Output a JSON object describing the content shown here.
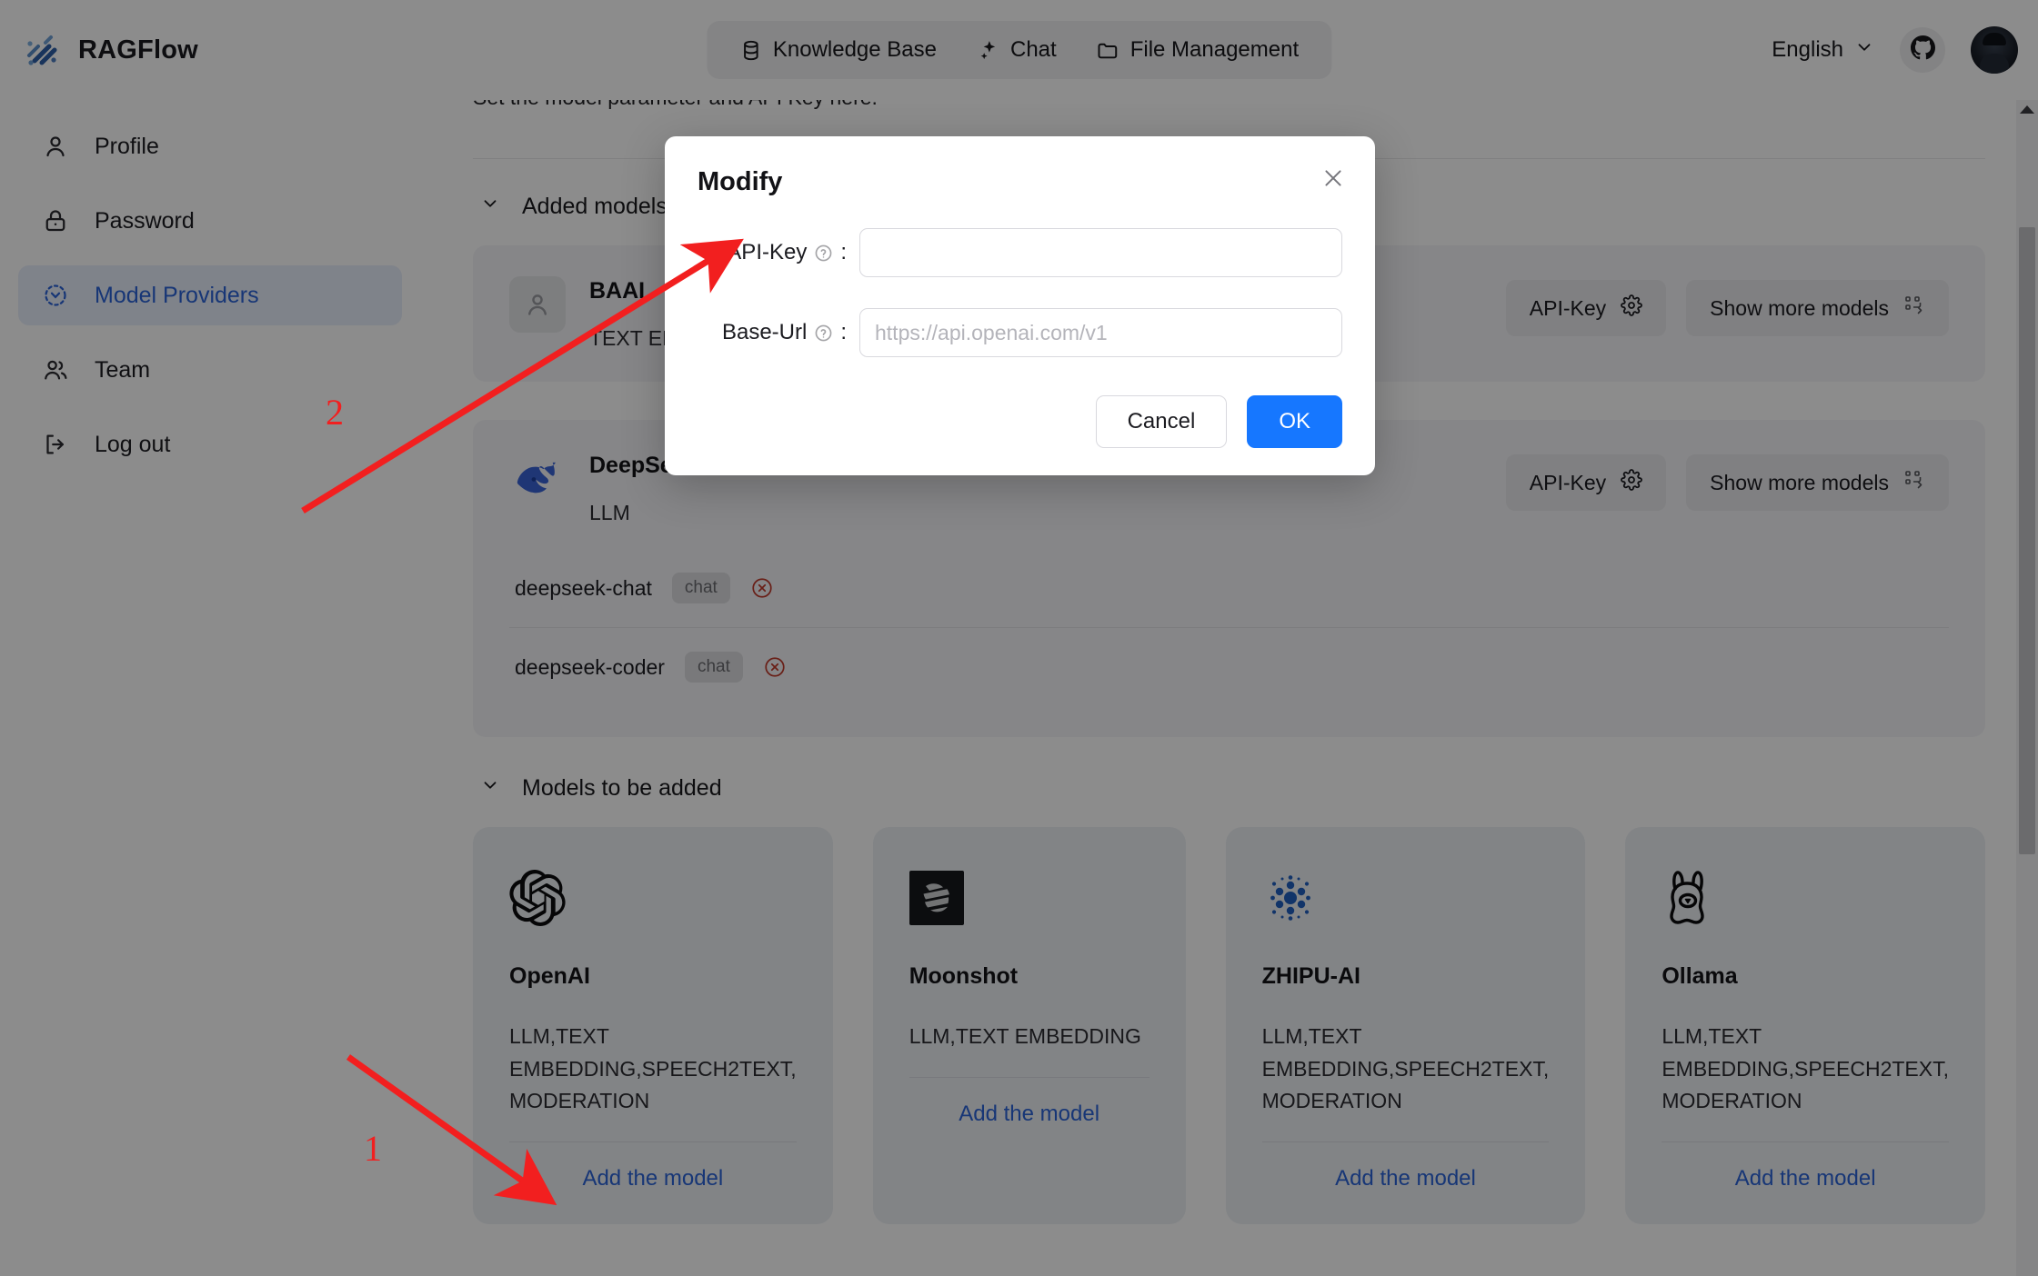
{
  "header": {
    "brand": "RAGFlow",
    "nav": [
      {
        "label": "Knowledge Base",
        "icon": "database-icon"
      },
      {
        "label": "Chat",
        "icon": "sparkle-icon"
      },
      {
        "label": "File Management",
        "icon": "folder-icon"
      }
    ],
    "language": "English",
    "github_icon": "github-icon",
    "avatar_icon": "user-avatar"
  },
  "sidebar": {
    "items": [
      {
        "label": "Profile",
        "icon": "user-icon",
        "active": false
      },
      {
        "label": "Password",
        "icon": "lock-icon",
        "active": false
      },
      {
        "label": "Model Providers",
        "icon": "model-providers-icon",
        "active": true
      },
      {
        "label": "Team",
        "icon": "team-icon",
        "active": false
      },
      {
        "label": "Log out",
        "icon": "logout-icon",
        "active": false
      }
    ]
  },
  "main": {
    "subtitle": "Set the model parameter and API Key here.",
    "added_models_header": "Added models",
    "to_be_added_header": "Models to be added",
    "added_providers": [
      {
        "name": "BAAI",
        "tags": "TEXT EMBEDDING",
        "api_key_label": "API-Key",
        "show_more_label": "Show more models",
        "models": []
      },
      {
        "name": "DeepSeek",
        "tags": "LLM",
        "api_key_label": "API-Key",
        "show_more_label": "Show more models",
        "models": [
          {
            "name": "deepseek-chat",
            "chip": "chat"
          },
          {
            "name": "deepseek-coder",
            "chip": "chat"
          }
        ]
      }
    ],
    "add_cards": [
      {
        "name": "OpenAI",
        "logo": "openai-logo",
        "tags": "LLM,TEXT EMBEDDING,SPEECH2TEXT, MODERATION",
        "link": "Add the model"
      },
      {
        "name": "Moonshot",
        "logo": "moonshot-logo",
        "tags": "LLM,TEXT EMBEDDING",
        "link": "Add the model"
      },
      {
        "name": "ZHIPU-AI",
        "logo": "zhipu-logo",
        "tags": "LLM,TEXT EMBEDDING,SPEECH2TEXT, MODERATION",
        "link": "Add the model"
      },
      {
        "name": "Ollama",
        "logo": "ollama-logo",
        "tags": "LLM,TEXT EMBEDDING,SPEECH2TEXT, MODERATION",
        "link": "Add the model"
      }
    ]
  },
  "modal": {
    "title": "Modify",
    "close_icon": "close-icon",
    "api_key_label": "API-Key",
    "api_key_value": "",
    "api_key_placeholder": "",
    "base_url_label": "Base-Url",
    "base_url_value": "",
    "base_url_placeholder": "https://api.openai.com/v1",
    "required_marker": "*",
    "colon": ":",
    "cancel_label": "Cancel",
    "ok_label": "OK"
  },
  "annotations": {
    "marker_1": "1",
    "marker_2": "2",
    "color": "#f21f1f"
  }
}
